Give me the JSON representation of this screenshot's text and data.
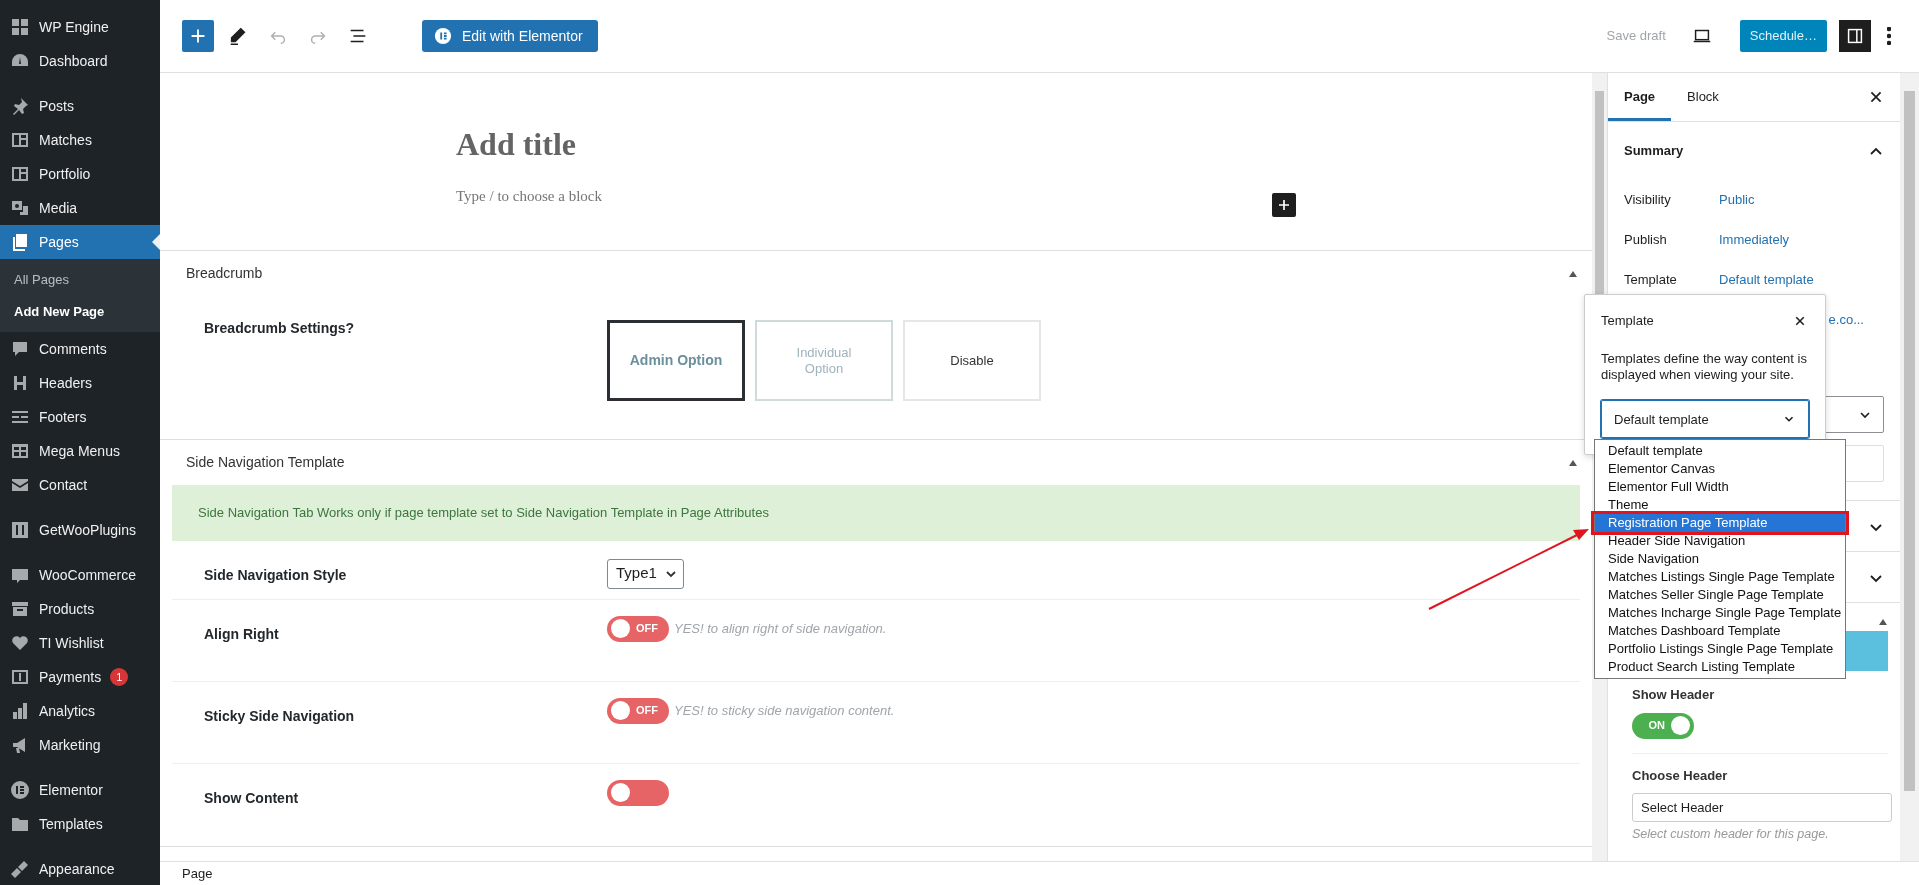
{
  "sidebar": {
    "groups": [
      [
        {
          "label": "WP Engine",
          "selected": false
        },
        {
          "label": "Dashboard",
          "selected": false
        }
      ],
      [
        {
          "label": "Posts",
          "selected": false
        },
        {
          "label": "Matches",
          "selected": false
        },
        {
          "label": "Portfolio",
          "selected": false
        },
        {
          "label": "Media",
          "selected": false
        },
        {
          "label": "Pages",
          "selected": true,
          "children": [
            {
              "label": "All Pages",
              "selected": false
            },
            {
              "label": "Add New Page",
              "selected": true
            }
          ]
        },
        {
          "label": "Comments",
          "selected": false
        },
        {
          "label": "Headers",
          "selected": false
        },
        {
          "label": "Footers",
          "selected": false
        },
        {
          "label": "Mega Menus",
          "selected": false
        },
        {
          "label": "Contact",
          "selected": false
        }
      ],
      [
        {
          "label": "GetWooPlugins",
          "selected": false
        }
      ],
      [
        {
          "label": "WooCommerce",
          "selected": false
        },
        {
          "label": "Products",
          "selected": false
        },
        {
          "label": "TI Wishlist",
          "selected": false
        },
        {
          "label": "Payments",
          "selected": false,
          "badge": "1"
        },
        {
          "label": "Analytics",
          "selected": false
        },
        {
          "label": "Marketing",
          "selected": false
        }
      ],
      [
        {
          "label": "Elementor",
          "selected": false
        },
        {
          "label": "Templates",
          "selected": false
        }
      ],
      [
        {
          "label": "Appearance",
          "selected": false
        }
      ]
    ]
  },
  "toolbar": {
    "tools": [
      {
        "kind": "add",
        "disabled": false
      },
      {
        "kind": "edit",
        "disabled": false
      },
      {
        "kind": "undo",
        "disabled": true
      },
      {
        "kind": "redo",
        "disabled": true
      },
      {
        "kind": "list",
        "disabled": false
      }
    ],
    "elementor_button": "Edit with Elementor",
    "save_draft": {
      "label": "Save draft",
      "disabled": true
    },
    "schedule_button": "Schedule…",
    "settings_toggle": {
      "pressed": true
    }
  },
  "editor": {
    "title_placeholder": "Add title",
    "block_placeholder": "Type / to choose a block"
  },
  "meta_boxes": [
    {
      "title": "Breadcrumb",
      "expanded": true,
      "rows": [
        {
          "kind": "choice",
          "label": "Breadcrumb Settings?",
          "options": [
            {
              "label": "Admin Option",
              "selected": true
            },
            {
              "label": "Individual Option",
              "selected": false
            },
            {
              "label": "Disable",
              "selected": false
            }
          ]
        }
      ]
    },
    {
      "title": "Side Navigation Template",
      "expanded": true,
      "notice": "Side Navigation Tab Works only if page template set to Side Navigation Template in Page Attributes",
      "rows": [
        {
          "kind": "select",
          "label": "Side Navigation Style",
          "value": "Type1"
        },
        {
          "kind": "toggle",
          "label": "Align Right",
          "on": false,
          "state_text": "OFF",
          "hint": "YES! to align right of side navigation."
        },
        {
          "kind": "toggle",
          "label": "Sticky Side Navigation",
          "on": false,
          "state_text": "OFF",
          "hint": "YES! to sticky side navigation content."
        },
        {
          "kind": "toggle",
          "label": "Show Content",
          "on": false
        }
      ]
    }
  ],
  "status_bar": {
    "breadcrumb": "Page"
  },
  "settings_panel": {
    "tabs": [
      {
        "label": "Page",
        "selected": true
      },
      {
        "label": "Block",
        "selected": false
      }
    ],
    "summary": {
      "title": "Summary",
      "expanded": true,
      "rows": [
        {
          "label": "Visibility",
          "value": "Public"
        },
        {
          "label": "Publish",
          "value": "Immediately"
        },
        {
          "label": "Template",
          "value": "Default template"
        }
      ],
      "url_fragment": "e.co..."
    },
    "sections": [
      {
        "expanded": false
      },
      {
        "expanded": false
      }
    ],
    "header_section": {
      "expanded": true,
      "show_header": {
        "label": "Show Header",
        "on": true,
        "state_text": "ON"
      },
      "choose_header": {
        "label": "Choose Header",
        "value": "Select Header",
        "help": "Select custom header for this page."
      }
    }
  },
  "template_popover": {
    "title": "Template",
    "description": "Templates define the way content is displayed when viewing your site.",
    "value": "Default template",
    "options": [
      {
        "label": "Default template",
        "highlighted": false
      },
      {
        "label": "Elementor Canvas",
        "highlighted": false
      },
      {
        "label": "Elementor Full Width",
        "highlighted": false
      },
      {
        "label": "Theme",
        "highlighted": false
      },
      {
        "label": "Registration Page Template",
        "highlighted": true
      },
      {
        "label": "Header Side Navigation",
        "highlighted": false
      },
      {
        "label": "Side Navigation",
        "highlighted": false
      },
      {
        "label": "Matches Listings Single Page Template",
        "highlighted": false
      },
      {
        "label": "Matches Seller Single Page Template",
        "highlighted": false
      },
      {
        "label": "Matches Incharge Single Page Template",
        "highlighted": false
      },
      {
        "label": "Matches Dashboard Template",
        "highlighted": false
      },
      {
        "label": "Portfolio Listings Single Page Template",
        "highlighted": false
      },
      {
        "label": "Product Search Listing Template",
        "highlighted": false
      }
    ]
  }
}
